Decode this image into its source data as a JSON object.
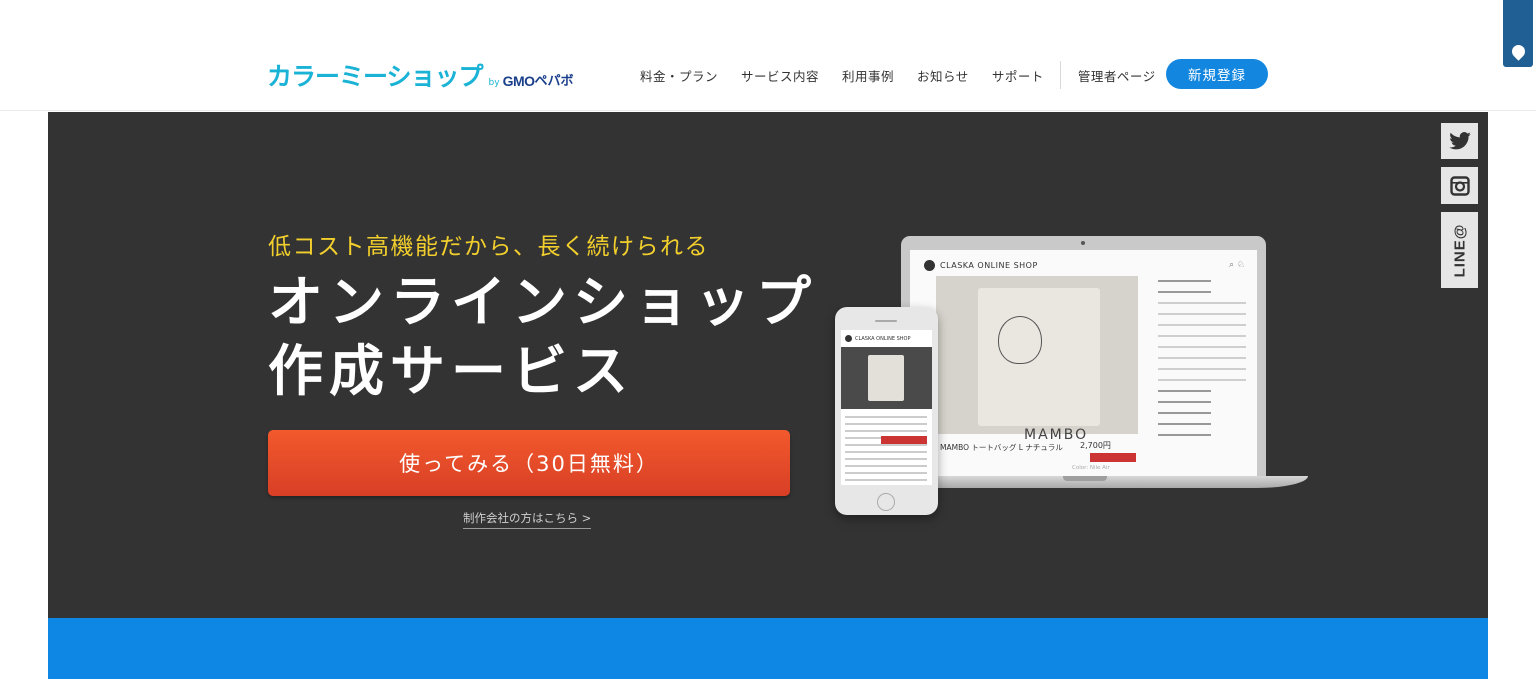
{
  "header": {
    "logo": {
      "main": "カラーミーショップ",
      "by": "by",
      "gmo": "GMO",
      "pepabo": "ペパボ"
    },
    "nav": [
      {
        "label": "料金・プラン"
      },
      {
        "label": "サービス内容"
      },
      {
        "label": "利用事例"
      },
      {
        "label": "お知らせ"
      },
      {
        "label": "サポート"
      }
    ],
    "admin_label": "管理者ページ",
    "signup_label": "新規登録"
  },
  "hero": {
    "tagline": "低コスト高機能だから、長く続けられる",
    "headline_line1": "オンラインショップ",
    "headline_line2": "作成サービス",
    "cta_label": "使ってみる（30日無料）",
    "agency_link": "制作会社の方はこちら >",
    "mockup": {
      "shop_name": "CLASKA ONLINE SHOP",
      "brand": "MAMBO",
      "product_title": "MAMBO トートバッグ L ナチュラル",
      "price": "2,700円",
      "caption": "Color: Nile Air"
    }
  },
  "social": {
    "twitter": "twitter-icon",
    "instagram": "instagram-icon",
    "line": "LINE@"
  },
  "colors": {
    "brand": "#1ab3d6",
    "accent": "#1387e0",
    "cta": "#e84a28",
    "hero_bg": "#333333",
    "tagline": "#f2cf2c",
    "band": "#0d87e3"
  }
}
